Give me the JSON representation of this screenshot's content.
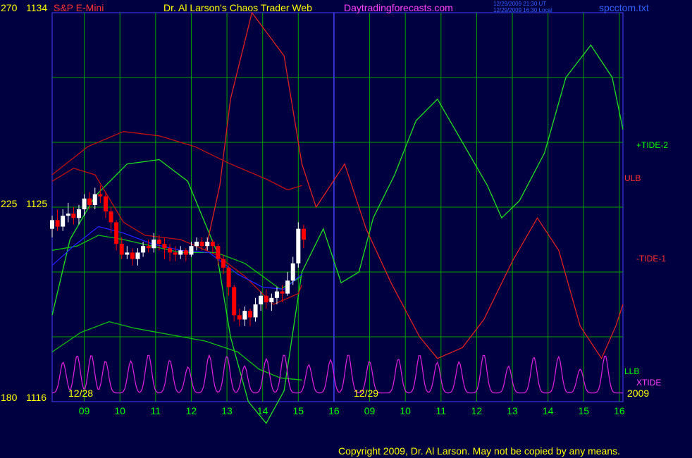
{
  "header": {
    "symbol": "S&P E-Mini",
    "title": "Dr. Al Larson's Chaos Trader Web",
    "site": "Daytradingforecasts.com",
    "timestamp_ut": "12/29/2009 21:30 UT",
    "timestamp_local": "12/29/2009 16:30 Local",
    "filename": "spcctom.txt"
  },
  "footer": {
    "copyright": "Copyright 2009, Dr. Al Larson. May not be copied by any means."
  },
  "colors": {
    "background": "#000040",
    "grid": "#00a000",
    "axis": "#4040ff",
    "label_yellow": "#ffff00",
    "label_green": "#00ff00",
    "label_red": "#ff3030",
    "label_magenta": "#ff40ff",
    "label_blue": "#3060ff",
    "price_up": "#ffffff",
    "price_down": "#ff0000",
    "tide2_line": "#20e020",
    "tide1_line": "#e02020",
    "ulb_line": "#c01010",
    "llb_line": "#10c010",
    "xtide_line": "#e020e0",
    "avg_line": "#2020ff"
  },
  "chart_data": {
    "type": "line",
    "y_left_labels": [
      {
        "label": "270",
        "price": "1134"
      },
      {
        "label": "225",
        "price": "1125"
      },
      {
        "label": "180",
        "price": "1116"
      }
    ],
    "ylim": [
      1116,
      1134
    ],
    "date_labels": [
      "12/28",
      "12/29",
      "2009"
    ],
    "x_ticks": [
      "09",
      "10",
      "11",
      "12",
      "13",
      "14",
      "15",
      "16",
      "09",
      "10",
      "11",
      "12",
      "13",
      "14",
      "15",
      "16"
    ],
    "series_labels": {
      "tide2": "+TIDE-2",
      "ulb": "ULB",
      "tide1": "-TIDE-1",
      "llb": "LLB",
      "xtide": "XTIDE"
    },
    "price_bars": [
      {
        "t": 0.0,
        "o": 1124.0,
        "c": 1124.4,
        "h": 1124.6,
        "l": 1123.6
      },
      {
        "t": 0.15,
        "o": 1124.4,
        "c": 1124.1,
        "h": 1124.9,
        "l": 1123.9
      },
      {
        "t": 0.3,
        "o": 1124.1,
        "c": 1124.6,
        "h": 1124.9,
        "l": 1123.9
      },
      {
        "t": 0.45,
        "o": 1124.6,
        "c": 1124.7,
        "h": 1125.2,
        "l": 1124.3
      },
      {
        "t": 0.6,
        "o": 1124.7,
        "c": 1124.5,
        "h": 1125.0,
        "l": 1124.2
      },
      {
        "t": 0.75,
        "o": 1124.5,
        "c": 1124.9,
        "h": 1125.1,
        "l": 1124.2
      },
      {
        "t": 0.9,
        "o": 1124.9,
        "c": 1125.4,
        "h": 1125.6,
        "l": 1124.6
      },
      {
        "t": 1.05,
        "o": 1125.4,
        "c": 1125.1,
        "h": 1125.7,
        "l": 1124.9
      },
      {
        "t": 1.2,
        "o": 1125.1,
        "c": 1125.6,
        "h": 1125.9,
        "l": 1124.9
      },
      {
        "t": 1.35,
        "o": 1125.6,
        "c": 1125.5,
        "h": 1126.0,
        "l": 1125.2
      },
      {
        "t": 1.5,
        "o": 1125.5,
        "c": 1124.8,
        "h": 1125.7,
        "l": 1124.5
      },
      {
        "t": 1.65,
        "o": 1124.8,
        "c": 1124.3,
        "h": 1125.0,
        "l": 1123.8
      },
      {
        "t": 1.8,
        "o": 1124.3,
        "c": 1123.3,
        "h": 1124.4,
        "l": 1123.0
      },
      {
        "t": 1.95,
        "o": 1123.3,
        "c": 1122.8,
        "h": 1123.6,
        "l": 1122.6
      },
      {
        "t": 2.1,
        "o": 1122.8,
        "c": 1122.9,
        "h": 1123.2,
        "l": 1122.6
      },
      {
        "t": 2.25,
        "o": 1122.9,
        "c": 1122.6,
        "h": 1123.1,
        "l": 1122.3
      },
      {
        "t": 2.4,
        "o": 1122.6,
        "c": 1122.9,
        "h": 1123.1,
        "l": 1122.3
      },
      {
        "t": 2.55,
        "o": 1122.9,
        "c": 1123.2,
        "h": 1123.4,
        "l": 1122.7
      },
      {
        "t": 2.7,
        "o": 1123.2,
        "c": 1123.1,
        "h": 1123.5,
        "l": 1122.9
      },
      {
        "t": 2.85,
        "o": 1123.1,
        "c": 1123.5,
        "h": 1123.8,
        "l": 1122.9
      },
      {
        "t": 3.0,
        "o": 1123.5,
        "c": 1123.3,
        "h": 1123.7,
        "l": 1123.0
      },
      {
        "t": 3.15,
        "o": 1123.3,
        "c": 1123.1,
        "h": 1123.6,
        "l": 1122.6
      },
      {
        "t": 3.3,
        "o": 1123.1,
        "c": 1122.9,
        "h": 1123.3,
        "l": 1122.5
      },
      {
        "t": 3.45,
        "o": 1122.9,
        "c": 1122.8,
        "h": 1123.2,
        "l": 1122.5
      },
      {
        "t": 3.6,
        "o": 1122.8,
        "c": 1123.0,
        "h": 1123.2,
        "l": 1122.6
      },
      {
        "t": 3.75,
        "o": 1123.0,
        "c": 1122.8,
        "h": 1123.1,
        "l": 1122.5
      },
      {
        "t": 3.9,
        "o": 1122.8,
        "c": 1123.2,
        "h": 1123.4,
        "l": 1122.7
      },
      {
        "t": 4.05,
        "o": 1123.2,
        "c": 1123.4,
        "h": 1123.6,
        "l": 1123.0
      },
      {
        "t": 4.2,
        "o": 1123.4,
        "c": 1123.2,
        "h": 1123.6,
        "l": 1123.0
      },
      {
        "t": 4.35,
        "o": 1123.2,
        "c": 1123.4,
        "h": 1123.6,
        "l": 1123.0
      },
      {
        "t": 4.5,
        "o": 1123.4,
        "c": 1123.2,
        "h": 1123.5,
        "l": 1122.9
      },
      {
        "t": 4.65,
        "o": 1123.2,
        "c": 1122.6,
        "h": 1123.3,
        "l": 1122.3
      },
      {
        "t": 4.8,
        "o": 1122.6,
        "c": 1122.2,
        "h": 1122.8,
        "l": 1121.9
      },
      {
        "t": 4.95,
        "o": 1122.2,
        "c": 1121.3,
        "h": 1122.3,
        "l": 1120.9
      },
      {
        "t": 5.1,
        "o": 1121.3,
        "c": 1120.0,
        "h": 1121.4,
        "l": 1119.7
      },
      {
        "t": 5.25,
        "o": 1120.0,
        "c": 1119.8,
        "h": 1120.3,
        "l": 1119.5
      },
      {
        "t": 5.4,
        "o": 1119.8,
        "c": 1120.2,
        "h": 1120.4,
        "l": 1119.5
      },
      {
        "t": 5.55,
        "o": 1120.2,
        "c": 1119.9,
        "h": 1120.3,
        "l": 1119.5
      },
      {
        "t": 5.7,
        "o": 1119.9,
        "c": 1120.5,
        "h": 1120.8,
        "l": 1119.7
      },
      {
        "t": 5.85,
        "o": 1120.5,
        "c": 1120.9,
        "h": 1121.1,
        "l": 1120.2
      },
      {
        "t": 6.0,
        "o": 1120.9,
        "c": 1120.6,
        "h": 1121.2,
        "l": 1120.3
      },
      {
        "t": 6.15,
        "o": 1120.6,
        "c": 1120.8,
        "h": 1121.0,
        "l": 1120.2
      },
      {
        "t": 6.3,
        "o": 1120.8,
        "c": 1121.1,
        "h": 1121.3,
        "l": 1120.5
      },
      {
        "t": 6.45,
        "o": 1121.1,
        "c": 1121.0,
        "h": 1121.4,
        "l": 1120.6
      },
      {
        "t": 6.6,
        "o": 1121.0,
        "c": 1121.6,
        "h": 1122.0,
        "l": 1120.9
      },
      {
        "t": 6.75,
        "o": 1121.6,
        "c": 1122.4,
        "h": 1122.7,
        "l": 1121.4
      },
      {
        "t": 6.9,
        "o": 1122.4,
        "c": 1124.0,
        "h": 1124.3,
        "l": 1122.2
      },
      {
        "t": 7.05,
        "o": 1124.0,
        "c": 1123.5,
        "h": 1124.2,
        "l": 1123.1
      }
    ],
    "series": [
      {
        "name": "+TIDE-2",
        "pts": [
          [
            0,
            1120
          ],
          [
            0.5,
            1123.5
          ],
          [
            1.2,
            1125.5
          ],
          [
            2.1,
            1127.0
          ],
          [
            3.0,
            1127.2
          ],
          [
            3.8,
            1126.2
          ],
          [
            4.6,
            1123.0
          ],
          [
            5.0,
            1119.0
          ],
          [
            5.5,
            1116.0
          ],
          [
            6.0,
            1115.0
          ],
          [
            6.5,
            1116.5
          ],
          [
            7.0,
            1122.0
          ],
          [
            7.6,
            1124.0
          ],
          [
            8.1,
            1121.5
          ],
          [
            8.6,
            1122.0
          ],
          [
            9.0,
            1124.5
          ],
          [
            9.6,
            1126.5
          ],
          [
            10.2,
            1129.0
          ],
          [
            10.8,
            1130.0
          ],
          [
            11.5,
            1128.0
          ],
          [
            12.2,
            1126.0
          ],
          [
            12.6,
            1124.5
          ],
          [
            13.1,
            1125.3
          ],
          [
            13.8,
            1127.5
          ],
          [
            14.4,
            1131.0
          ],
          [
            15.1,
            1132.5
          ],
          [
            15.7,
            1131.0
          ],
          [
            16.0,
            1128.6
          ]
        ]
      },
      {
        "name": "-TIDE-1",
        "pts": [
          [
            4.3,
            1123.0
          ],
          [
            4.7,
            1126.0
          ],
          [
            5.0,
            1130.0
          ],
          [
            5.6,
            1134.0
          ],
          [
            6.5,
            1132.0
          ],
          [
            7.0,
            1127.0
          ],
          [
            7.4,
            1125.0
          ],
          [
            8.2,
            1127.0
          ],
          [
            8.8,
            1124.0
          ],
          [
            9.5,
            1121.5
          ],
          [
            10.3,
            1119.0
          ],
          [
            10.8,
            1118.0
          ],
          [
            11.5,
            1118.5
          ],
          [
            12.1,
            1119.8
          ],
          [
            12.9,
            1122.5
          ],
          [
            13.6,
            1124.5
          ],
          [
            14.2,
            1123.0
          ],
          [
            14.8,
            1119.5
          ],
          [
            15.4,
            1118.0
          ],
          [
            15.8,
            1119.5
          ],
          [
            16.0,
            1120.5
          ]
        ]
      },
      {
        "name": "ULB",
        "pts": [
          [
            0,
            1126.5
          ],
          [
            1.0,
            1127.8
          ],
          [
            2.0,
            1128.5
          ],
          [
            3.0,
            1128.3
          ],
          [
            4.0,
            1127.8
          ],
          [
            5.0,
            1127.0
          ],
          [
            6.0,
            1126.3
          ],
          [
            6.6,
            1125.8
          ],
          [
            7.0,
            1126.0
          ]
        ]
      },
      {
        "name": "ULB2",
        "pts": [
          [
            0,
            1126.2
          ],
          [
            0.6,
            1126.8
          ],
          [
            1.2,
            1126.5
          ],
          [
            2.0,
            1124.3
          ],
          [
            2.6,
            1123.7
          ],
          [
            3.6,
            1123.5
          ],
          [
            4.6,
            1122.8
          ],
          [
            5.4,
            1121.8
          ],
          [
            6.2,
            1120.5
          ],
          [
            6.9,
            1121.0
          ],
          [
            7.0,
            1121.4
          ]
        ]
      },
      {
        "name": "LLB",
        "pts": [
          [
            0,
            1118.3
          ],
          [
            0.8,
            1119.2
          ],
          [
            1.6,
            1119.7
          ],
          [
            2.3,
            1119.4
          ],
          [
            3.3,
            1119.1
          ],
          [
            4.3,
            1118.8
          ],
          [
            5.2,
            1118.3
          ],
          [
            5.8,
            1117.5
          ],
          [
            6.4,
            1117.1
          ],
          [
            7.0,
            1117.0
          ]
        ]
      },
      {
        "name": "LLB2",
        "pts": [
          [
            0,
            1123.0
          ],
          [
            0.7,
            1123.2
          ],
          [
            1.3,
            1123.7
          ],
          [
            2.0,
            1123.5
          ],
          [
            2.8,
            1123.2
          ],
          [
            3.6,
            1122.9
          ],
          [
            4.6,
            1122.9
          ],
          [
            5.4,
            1122.4
          ],
          [
            6.4,
            1121.2
          ],
          [
            7.0,
            1121.8
          ]
        ]
      },
      {
        "name": "AVG",
        "pts": [
          [
            0,
            1122.3
          ],
          [
            0.6,
            1123.2
          ],
          [
            1.3,
            1124.1
          ],
          [
            2.0,
            1123.8
          ],
          [
            2.8,
            1123.3
          ],
          [
            3.6,
            1123.0
          ],
          [
            4.4,
            1122.9
          ],
          [
            5.2,
            1121.9
          ],
          [
            5.9,
            1121.3
          ],
          [
            6.5,
            1121.2
          ],
          [
            7.0,
            1121.9
          ]
        ]
      }
    ],
    "xtide_peaks": [
      0.3,
      0.7,
      1.1,
      1.5,
      2.2,
      2.7,
      3.3,
      3.8,
      4.4,
      4.9,
      5.4,
      6.0,
      6.5,
      7.2,
      7.8,
      8.3,
      8.9,
      9.7,
      10.3,
      10.8,
      11.4,
      12.1,
      12.8,
      13.5,
      14.2,
      14.8,
      15.5
    ]
  }
}
